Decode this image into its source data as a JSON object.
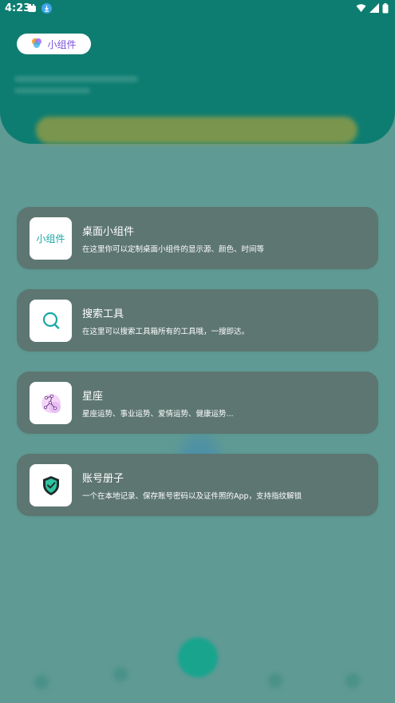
{
  "status_bar": {
    "time": "4:23",
    "left_icons": [
      "notification-icon",
      "download-icon"
    ],
    "right_icons": [
      "wifi-icon",
      "signal-icon",
      "battery-icon"
    ]
  },
  "chip": {
    "label": "小组件",
    "icon": "app-logo-icon"
  },
  "cards": [
    {
      "title": "桌面小组件",
      "description": "在这里你可以定制桌面小组件的显示源、颜色、时间等",
      "icon_text": "小组件"
    },
    {
      "title": "搜索工具",
      "description": "在这里可以搜索工具箱所有的工具哦，一搜即达。",
      "icon": "search-icon"
    },
    {
      "title": "星座",
      "description": "星座运势、事业运势、爱情运势、健康运势...",
      "icon": "constellation-icon"
    },
    {
      "title": "账号册子",
      "description": "一个在本地记录、保存账号密码以及证件照的App，支持指纹解锁",
      "icon": "shield-check-icon"
    }
  ],
  "colors": {
    "header": "#0e7d71",
    "overlay": "#5f9a94",
    "card": "#5d7671",
    "chip_text": "#7b4fe0",
    "icon_accent": "#1aa7a5"
  }
}
